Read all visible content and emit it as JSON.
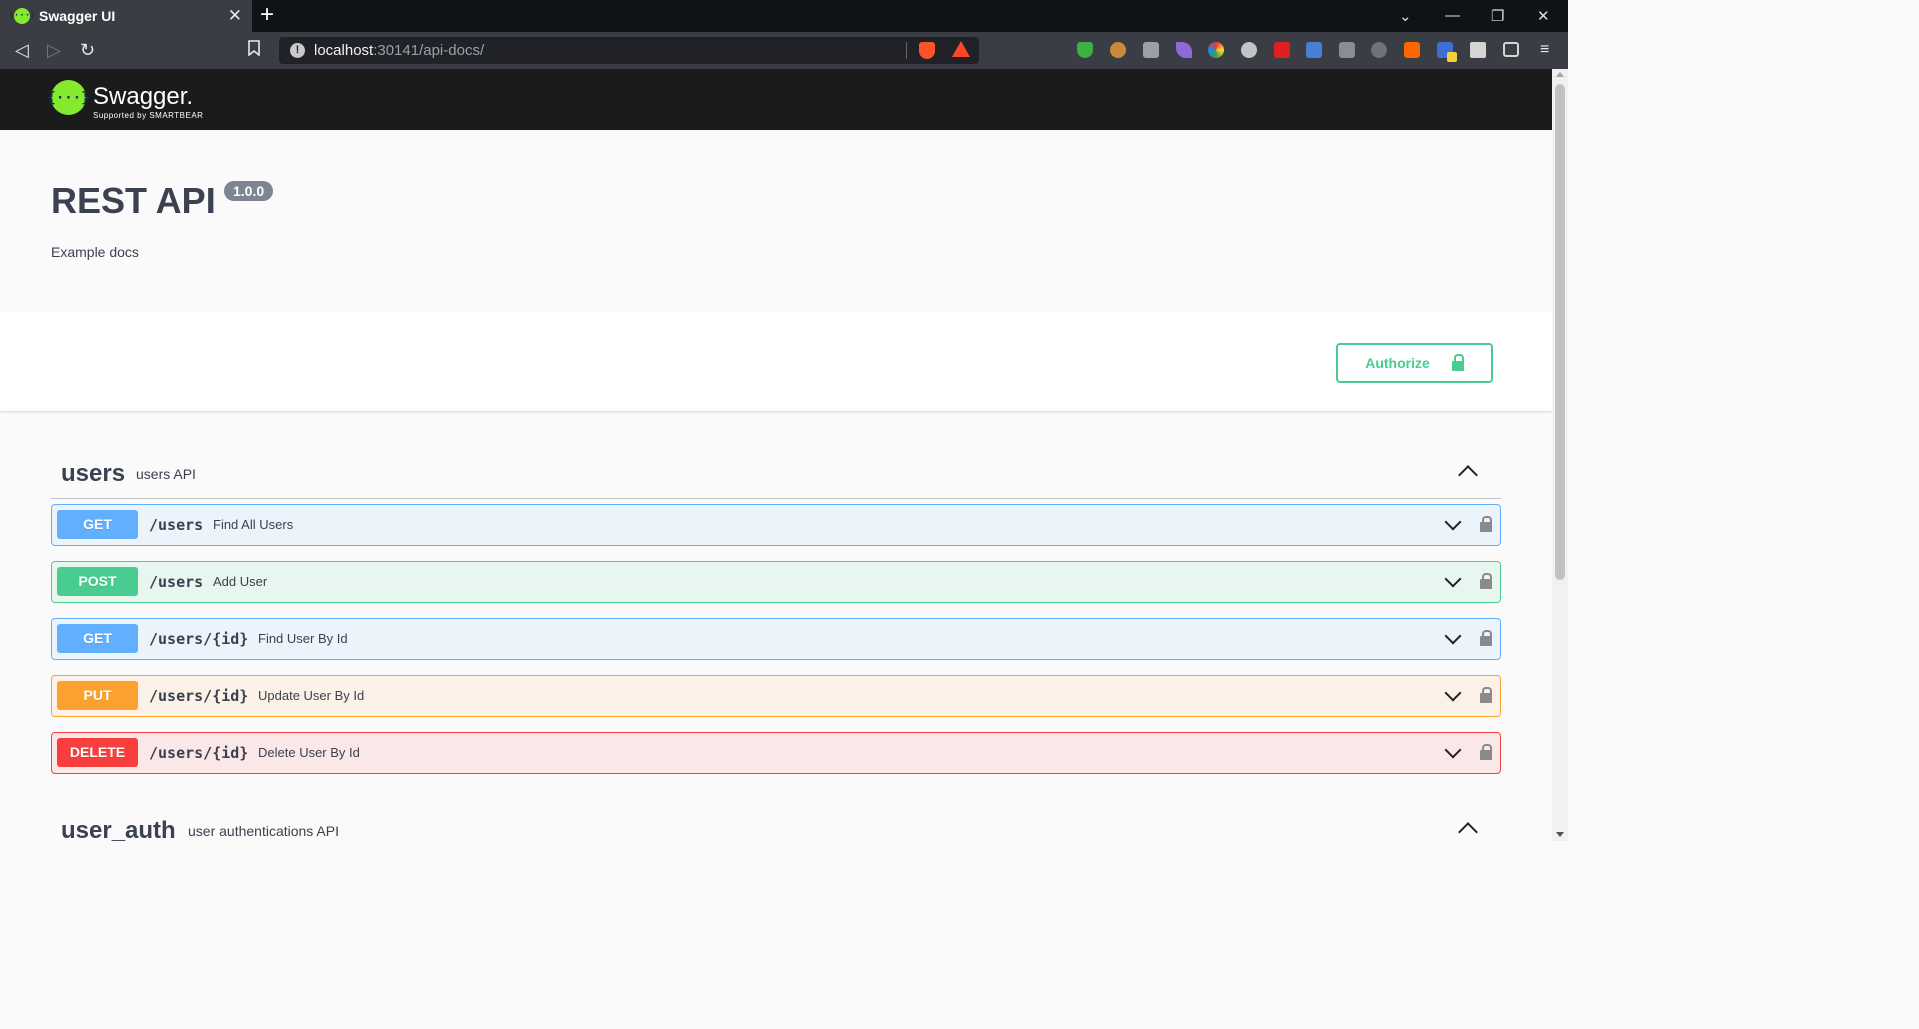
{
  "browser": {
    "tab_title": "Swagger UI",
    "tab_close": "✕",
    "new_tab": "+",
    "url_host": "localhost",
    "url_rest": ":30141/api-docs/",
    "controls": {
      "minimize": "—",
      "restore": "❐",
      "close": "✕",
      "list": "⌄"
    },
    "nav": {
      "back": "◁",
      "forward": "▷",
      "reload": "↻",
      "bookmark": "🔖"
    }
  },
  "swagger": {
    "logo_mark": "{···}",
    "logo_text": "Swagger.",
    "logo_sub": "Supported by SMARTBEAR"
  },
  "info": {
    "title": "REST API",
    "version": "1.0.0",
    "description": "Example docs"
  },
  "authorize_label": "Authorize",
  "tags": [
    {
      "name": "users",
      "description": "users API",
      "operations": [
        {
          "method": "GET",
          "path": "/users",
          "summary": "Find All Users"
        },
        {
          "method": "POST",
          "path": "/users",
          "summary": "Add User"
        },
        {
          "method": "GET",
          "path": "/users/{id}",
          "summary": "Find User By Id"
        },
        {
          "method": "PUT",
          "path": "/users/{id}",
          "summary": "Update User By Id"
        },
        {
          "method": "DELETE",
          "path": "/users/{id}",
          "summary": "Delete User By Id"
        }
      ]
    },
    {
      "name": "user_auth",
      "description": "user authentications API"
    }
  ],
  "colors": {
    "get": "#61affe",
    "post": "#49cc90",
    "put": "#fca130",
    "delete": "#f93e3e"
  },
  "extension_icons": [
    "shield-icon",
    "cookie-icon",
    "camera-icon",
    "feather-icon",
    "color-icon",
    "gear-icon",
    "pdf-icon",
    "translate-icon",
    "window-icon",
    "music-icon",
    "y-icon",
    "badge-icon",
    "puzzle-icon",
    "wallet-icon",
    "menu-icon"
  ]
}
